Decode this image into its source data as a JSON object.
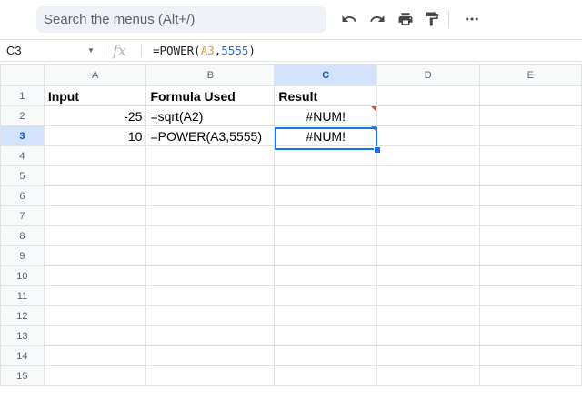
{
  "toolbar": {
    "search_placeholder": "Search the menus (Alt+/)",
    "icons": [
      "undo-icon",
      "redo-icon",
      "print-icon",
      "paint-format-icon",
      "more-icon"
    ]
  },
  "formula_bar": {
    "cell_ref": "C3",
    "fx_label": "fx",
    "formula_prefix": "=POWER(",
    "formula_ref": "A3",
    "formula_comma": ",",
    "formula_number": "5555",
    "formula_suffix": ")"
  },
  "columns": [
    "A",
    "B",
    "C",
    "D",
    "E"
  ],
  "rows": [
    "1",
    "2",
    "3",
    "4",
    "5",
    "6",
    "7",
    "8",
    "9",
    "10",
    "11",
    "12",
    "13",
    "14",
    "15"
  ],
  "cells": {
    "A1": "Input",
    "B1": "Formula Used",
    "C1": "Result",
    "A2": "-25",
    "B2": "=sqrt(A2)",
    "C2": "#NUM!",
    "A3": "10",
    "B3": "=POWER(A3,5555)",
    "C3": "#NUM!"
  },
  "colors": {
    "selection": "#1a73e8",
    "error_marker": "#db4437",
    "header_selected": "#d3e3fd"
  }
}
